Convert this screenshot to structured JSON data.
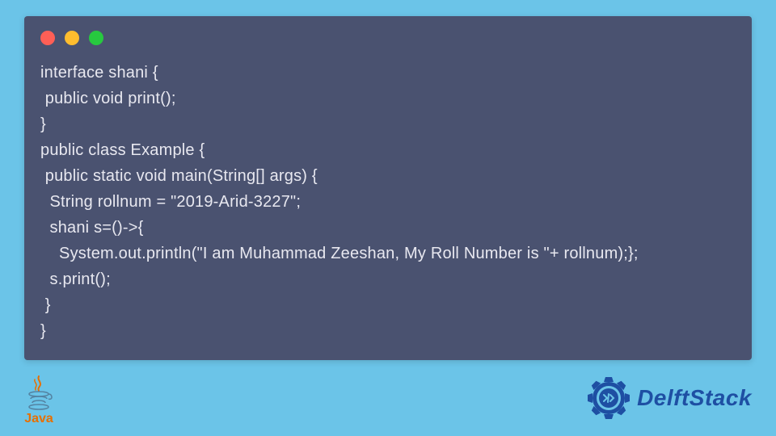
{
  "code": {
    "lines": [
      "interface shani {",
      " public void print();",
      "}",
      "public class Example {",
      " public static void main(String[] args) {",
      "  String rollnum = \"2019-Arid-3227\";",
      "  shani s=()->{",
      "    System.out.println(\"I am Muhammad Zeeshan, My Roll Number is \"+ rollnum);};",
      "  s.print();",
      " }",
      "}"
    ]
  },
  "logos": {
    "java_label": "Java",
    "delft_label": "DelftStack"
  },
  "window": {
    "controls": {
      "red": "close",
      "yellow": "minimize",
      "green": "maximize"
    }
  }
}
